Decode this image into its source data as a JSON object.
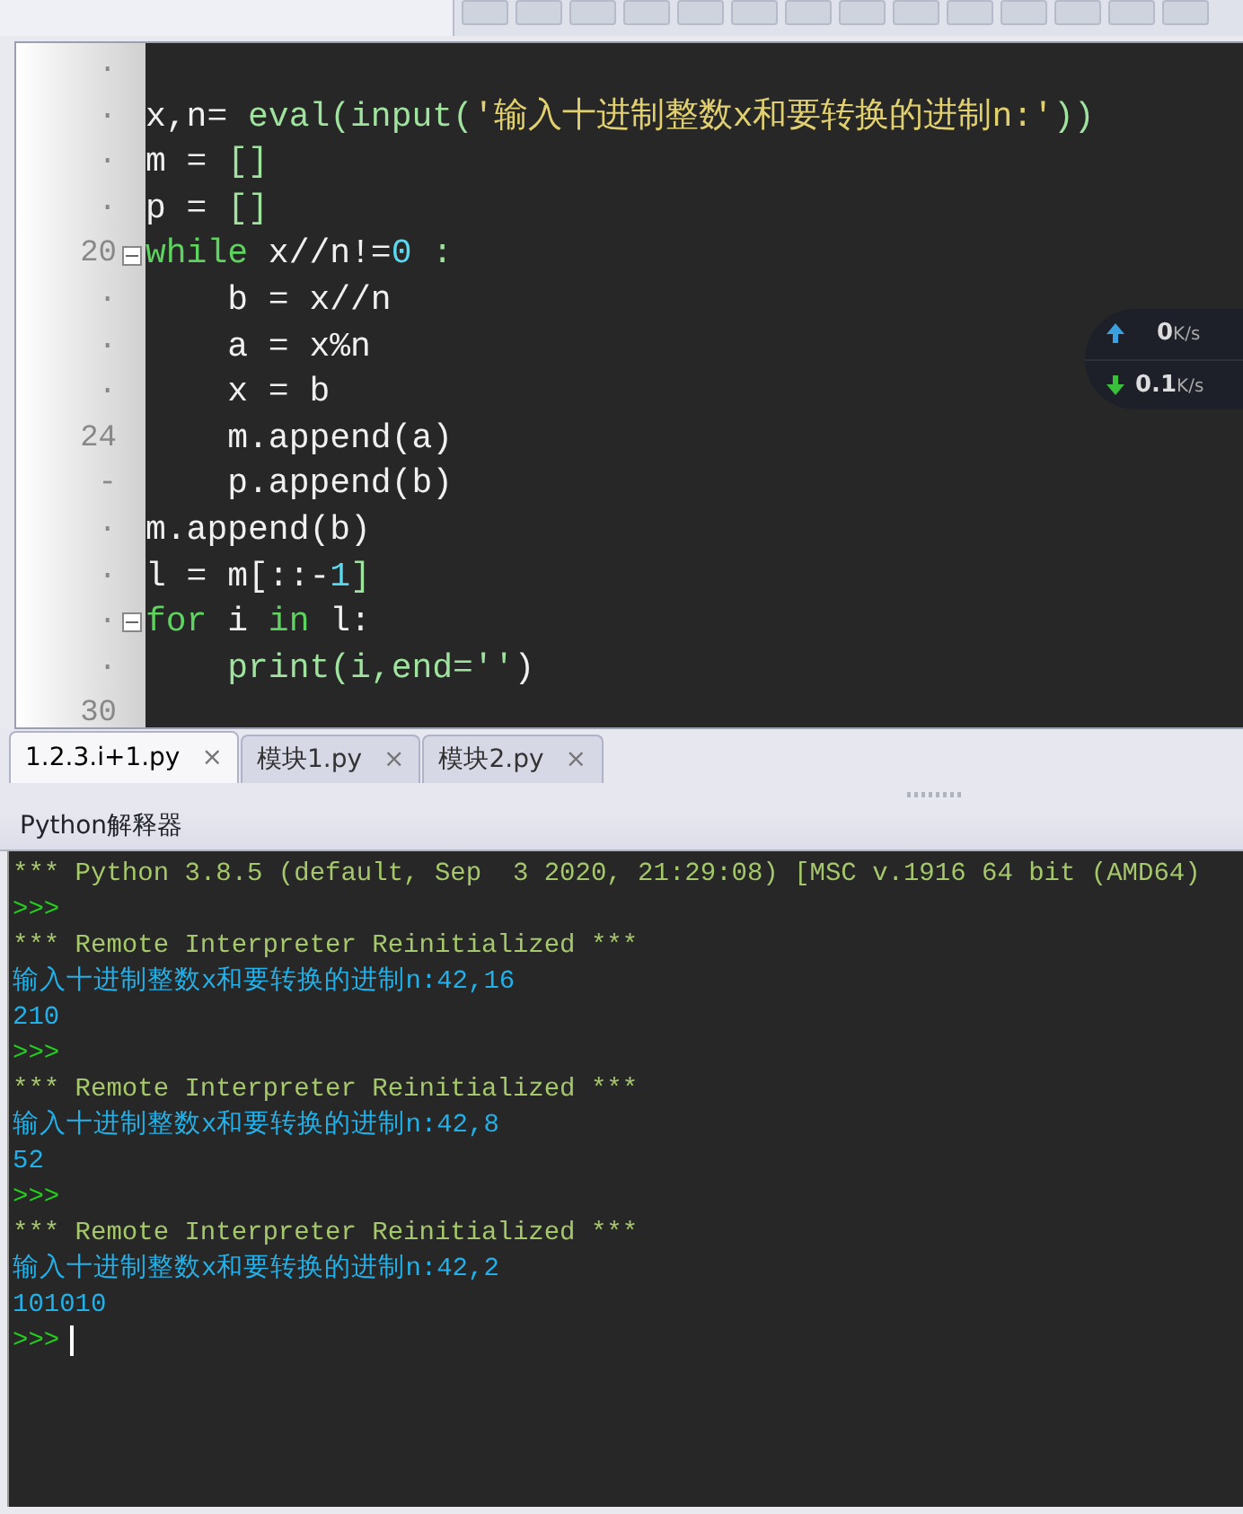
{
  "editor": {
    "lines": [
      {
        "gutter": "·",
        "fold": false
      },
      {
        "gutter": "·",
        "fold": false,
        "tokens": [
          {
            "text": "x,n= ",
            "kind": "id"
          },
          {
            "text": "eval(input(",
            "kind": "fn"
          },
          {
            "text": "'输入十进制整数x和要转换的进制n:'",
            "kind": "str"
          },
          {
            "text": "))",
            "kind": "fn"
          }
        ]
      },
      {
        "gutter": "·",
        "fold": false,
        "tokens": [
          {
            "text": "m = ",
            "kind": "id"
          },
          {
            "text": "[]",
            "kind": "fn"
          }
        ]
      },
      {
        "gutter": "·",
        "fold": false,
        "tokens": [
          {
            "text": "p = ",
            "kind": "id"
          },
          {
            "text": "[]",
            "kind": "fn"
          }
        ]
      },
      {
        "gutter": "20",
        "fold": true,
        "tokens": [
          {
            "text": "while ",
            "kind": "kw"
          },
          {
            "text": "x//n!=",
            "kind": "id"
          },
          {
            "text": "0",
            "kind": "num"
          },
          {
            "text": " :",
            "kind": "fn"
          }
        ]
      },
      {
        "gutter": "·",
        "fold": false,
        "tokens": [
          {
            "text": "    b = x//n",
            "kind": "id"
          }
        ]
      },
      {
        "gutter": "·",
        "fold": false,
        "tokens": [
          {
            "text": "    a = x%n",
            "kind": "id"
          }
        ]
      },
      {
        "gutter": "·",
        "fold": false,
        "tokens": [
          {
            "text": "    x = b",
            "kind": "id"
          }
        ]
      },
      {
        "gutter": "24",
        "fold": false,
        "tokens": [
          {
            "text": "    m.append(a)",
            "kind": "id"
          }
        ]
      },
      {
        "gutter": "-",
        "fold": false,
        "tokens": [
          {
            "text": "    p.append(b)",
            "kind": "id"
          }
        ]
      },
      {
        "gutter": "·",
        "fold": false,
        "tokens": [
          {
            "text": "m.append(b)",
            "kind": "id"
          }
        ]
      },
      {
        "gutter": "·",
        "fold": false,
        "tokens": [
          {
            "text": "l = m[::-",
            "kind": "id"
          },
          {
            "text": "1",
            "kind": "num"
          },
          {
            "text": "]",
            "kind": "fn"
          }
        ]
      },
      {
        "gutter": "·",
        "fold": true,
        "tokens": [
          {
            "text": "for ",
            "kind": "kw"
          },
          {
            "text": "i ",
            "kind": "id"
          },
          {
            "text": "in ",
            "kind": "kw"
          },
          {
            "text": "l:",
            "kind": "id"
          }
        ]
      },
      {
        "gutter": "·",
        "fold": false,
        "tokens": [
          {
            "text": "    print(i,end=''",
            "kind": "fn"
          },
          {
            "text": ")",
            "kind": "id"
          }
        ]
      },
      {
        "gutter": "30",
        "fold": false
      }
    ]
  },
  "net_speed": {
    "up": "0",
    "up_unit": "K/s",
    "down": "0.1",
    "down_unit": "K/s"
  },
  "tabs": [
    {
      "label": "1.2.3.i+1.py",
      "close": "×",
      "selected": true
    },
    {
      "label": "模块1.py",
      "close": "×",
      "selected": false
    },
    {
      "label": "模块2.py",
      "close": "×",
      "selected": false
    }
  ],
  "console": {
    "title": "Python解释器",
    "lines": [
      {
        "kind": "banner",
        "text": "*** Python 3.8.5 (default, Sep  3 2020, 21:29:08) [MSC v.1916 64 bit (AMD64)"
      },
      {
        "kind": "prompt",
        "text": ">>>"
      },
      {
        "kind": "banner",
        "text": "*** Remote Interpreter Reinitialized ***"
      },
      {
        "kind": "output",
        "text": "输入十进制整数x和要转换的进制n:42,16"
      },
      {
        "kind": "output",
        "text": "210"
      },
      {
        "kind": "prompt",
        "text": ">>>"
      },
      {
        "kind": "banner",
        "text": "*** Remote Interpreter Reinitialized ***"
      },
      {
        "kind": "output",
        "text": "输入十进制整数x和要转换的进制n:42,8"
      },
      {
        "kind": "output",
        "text": "52"
      },
      {
        "kind": "prompt",
        "text": ">>>"
      },
      {
        "kind": "banner",
        "text": "*** Remote Interpreter Reinitialized ***"
      },
      {
        "kind": "output",
        "text": "输入十进制整数x和要转换的进制n:42,2"
      },
      {
        "kind": "output",
        "text": "101010"
      },
      {
        "kind": "prompt",
        "text": ">>>",
        "cursor": true
      }
    ]
  }
}
